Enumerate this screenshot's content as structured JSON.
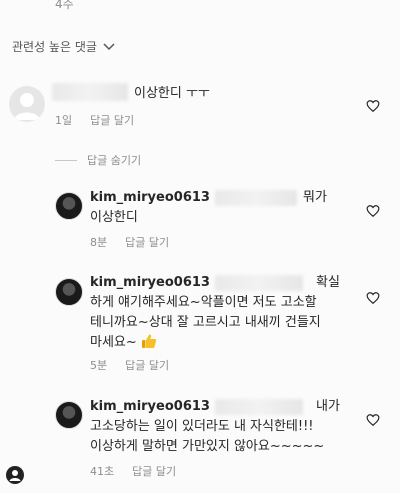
{
  "top_count": "4주",
  "sort": {
    "label": "관련성 높은 댓글"
  },
  "comments": [
    {
      "text": "이상한디 ㅜㅜ",
      "time": "1일",
      "reply": "답글 달기"
    }
  ],
  "hide_replies": "답글 숨기기",
  "replies": [
    {
      "username": "kim_miryeo0613",
      "line1_tail": "뭐가",
      "line2": "이상한디",
      "time": "8분",
      "reply": "답글 달기"
    },
    {
      "username": "kim_miryeo0613",
      "line1_tail": "확실",
      "line2": "하게 얘기해주세요~악플이면 저도 고소할",
      "line3": "테니까요~상대 잘 고르시고 내새끼 건들지",
      "line4": "마세요~",
      "time": "5분",
      "reply": "답글 달기"
    },
    {
      "username": "kim_miryeo0613",
      "line1_tail": "내가",
      "line2": "고소당하는 일이 있더라도 내 자식한테!!!",
      "line3": "이상하게 말하면 가만있지 않아요~~~~~",
      "time": "41초",
      "reply": "답글 달기"
    }
  ]
}
